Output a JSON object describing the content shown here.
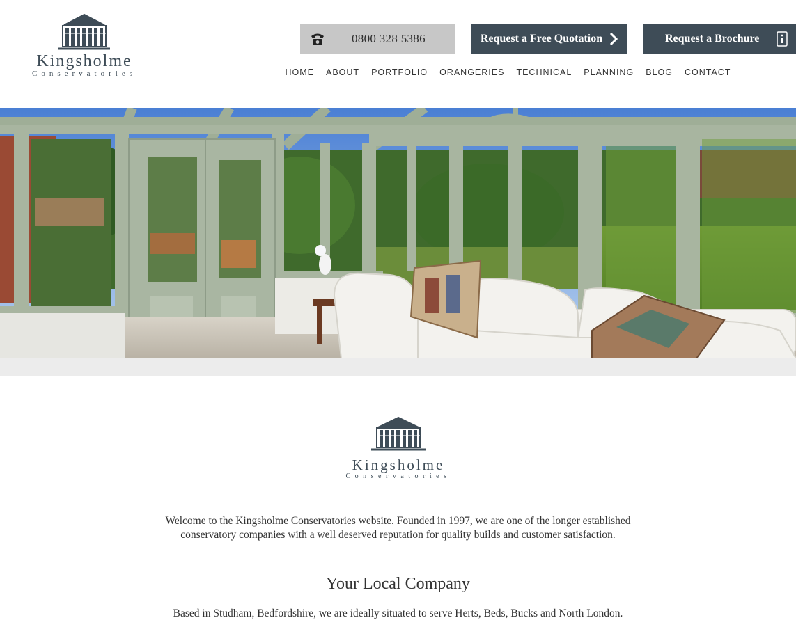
{
  "brand": {
    "name": "Kingsholme",
    "tagline": "Conservatories",
    "color": "#3e4c57"
  },
  "header": {
    "phone": {
      "icon": "phone-icon",
      "number": "0800 328 5386"
    },
    "quote_button": {
      "label": "Request a Free Quotation",
      "icon": "chevron-right-icon"
    },
    "brochure_button": {
      "label": "Request a Brochure",
      "icon": "info-icon"
    },
    "nav": [
      "HOME",
      "ABOUT",
      "PORTFOLIO",
      "ORANGERIES",
      "TECHNICAL",
      "PLANNING",
      "BLOG",
      "CONTACT"
    ]
  },
  "hero": {
    "image": "conservatory-interior-photo"
  },
  "content": {
    "welcome": "Welcome to the Kingsholme Conservatories website. Founded in 1997, we are one of the longer established conservatory companies with a well deserved reputation for quality builds and customer satisfaction.",
    "section_title": "Your Local Company",
    "section_text": "Based in Studham, Bedfordshire, we are ideally situated to serve Herts, Beds, Bucks and North London."
  },
  "colors": {
    "primary": "#3e4c57",
    "phone_bg": "#c7c7c7",
    "band": "#ececec"
  }
}
